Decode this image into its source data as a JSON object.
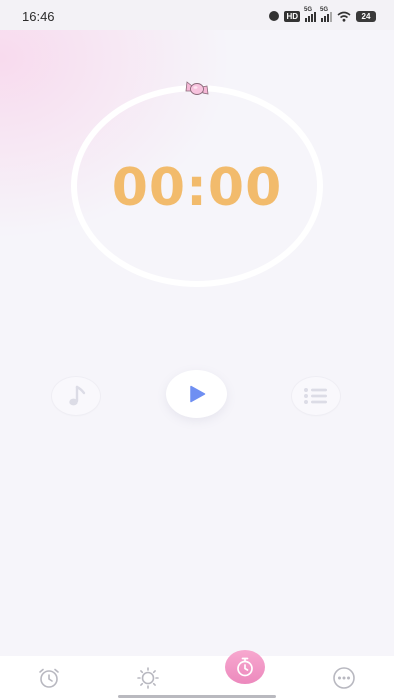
{
  "status_bar": {
    "time": "16:46",
    "hd_label": "HD",
    "signal1_label": "5G",
    "signal2_label": "5G",
    "battery": "24"
  },
  "timer": {
    "display": "00:00"
  },
  "controls": {
    "music_icon": "music-note-icon",
    "play_icon": "play-icon",
    "list_icon": "list-icon"
  },
  "bottom_nav": {
    "items": [
      {
        "icon": "alarm-clock-icon",
        "active": false
      },
      {
        "icon": "sun-icon",
        "active": false
      },
      {
        "icon": "stopwatch-icon",
        "active": true
      },
      {
        "icon": "more-icon",
        "active": false
      }
    ],
    "active_color": "#ec89bd"
  },
  "colors": {
    "timer_text": "#f2bb6c",
    "play_accent": "#6f8ff2",
    "background": "#f6f5fa"
  }
}
